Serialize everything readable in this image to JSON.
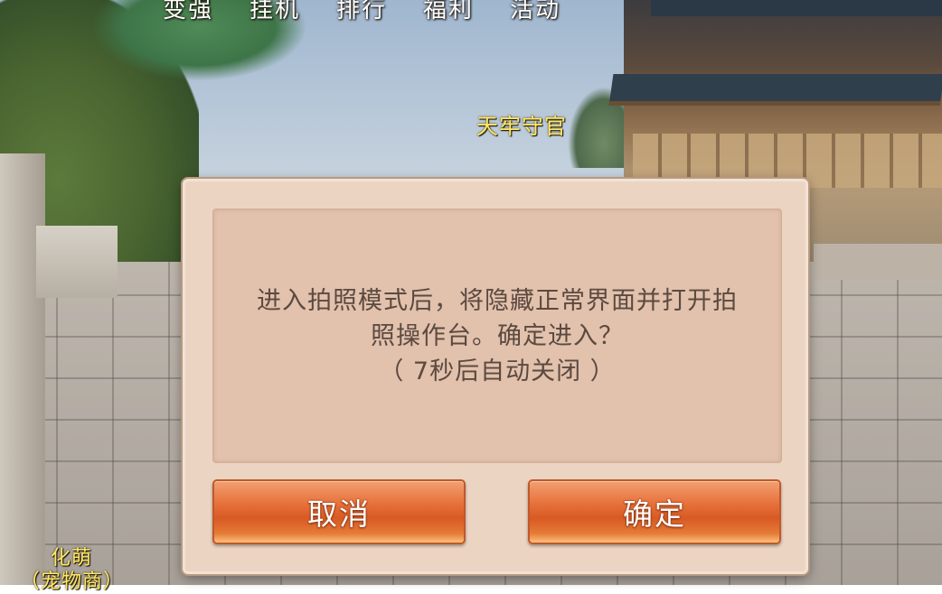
{
  "top_menu": [
    "变强",
    "挂机",
    "排行",
    "福利",
    "活动"
  ],
  "npc_labels": {
    "top": "天牢守官",
    "bottom_name": "化萌",
    "bottom_title": "（宠物商）"
  },
  "dialog": {
    "message_line1": "进入拍照模式后，将隐藏正常界面并打开拍",
    "message_line2": "照操作台。确定进入？",
    "message_line3": "（ 7秒后自动关闭 ）",
    "cancel_label": "取消",
    "confirm_label": "确定"
  }
}
